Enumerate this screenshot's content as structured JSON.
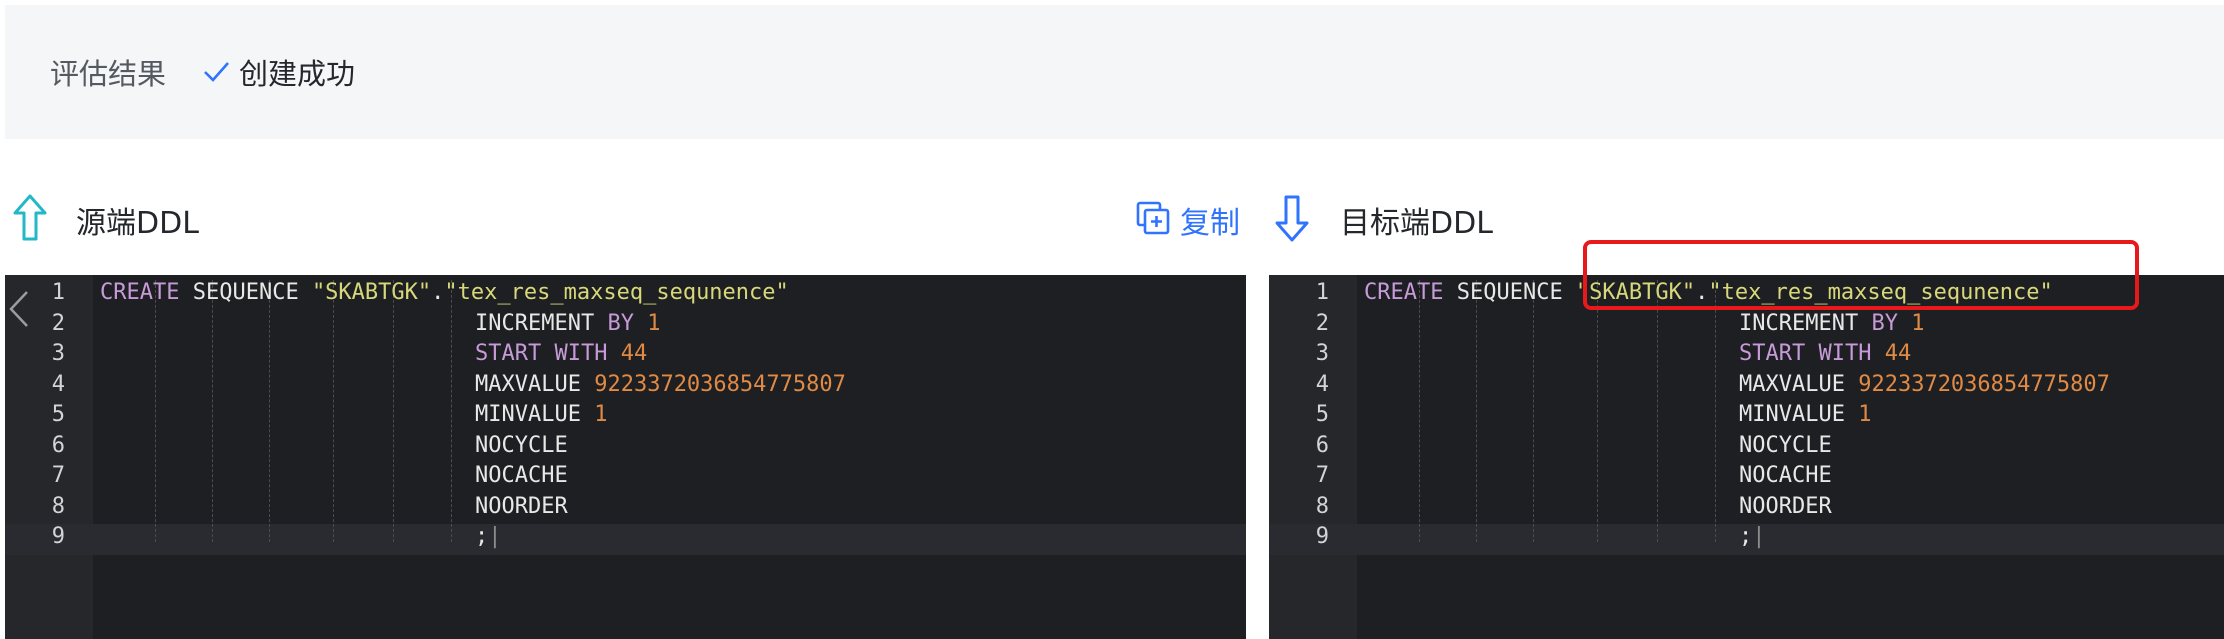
{
  "result": {
    "label": "评估结果",
    "status": "创建成功"
  },
  "source_panel": {
    "title": "源端DDL"
  },
  "target_panel": {
    "title": "目标端DDL"
  },
  "copy_button": {
    "label": "复制"
  },
  "code": {
    "line_numbers": [
      "1",
      "2",
      "3",
      "4",
      "5",
      "6",
      "7",
      "8",
      "9"
    ],
    "lines": [
      [
        {
          "t": "kw",
          "v": "CREATE"
        },
        {
          "t": "plain",
          "v": " SEQUENCE "
        },
        {
          "t": "str",
          "v": "\"SKABTGK\""
        },
        {
          "t": "plain",
          "v": "."
        },
        {
          "t": "str",
          "v": "\"tex_res_maxseq_sequnence\""
        }
      ],
      [
        {
          "t": "plain",
          "v": "INCREMENT "
        },
        {
          "t": "kw",
          "v": "BY"
        },
        {
          "t": "plain",
          "v": " "
        },
        {
          "t": "num",
          "v": "1"
        }
      ],
      [
        {
          "t": "kw",
          "v": "START WITH"
        },
        {
          "t": "plain",
          "v": " "
        },
        {
          "t": "num",
          "v": "44"
        }
      ],
      [
        {
          "t": "plain",
          "v": "MAXVALUE "
        },
        {
          "t": "num",
          "v": "9223372036854775807"
        }
      ],
      [
        {
          "t": "plain",
          "v": "MINVALUE "
        },
        {
          "t": "num",
          "v": "1"
        }
      ],
      [
        {
          "t": "plain",
          "v": "NOCYCLE"
        }
      ],
      [
        {
          "t": "plain",
          "v": "NOCACHE"
        }
      ],
      [
        {
          "t": "plain",
          "v": "NOORDER"
        }
      ],
      [
        {
          "t": "plain",
          "v": ";"
        }
      ]
    ]
  },
  "colors": {
    "accent": "#2f73ff",
    "success": "#2f73ff",
    "source_arrow": "#22b8c8",
    "target_arrow": "#2f73ff",
    "highlight": "#e8191a"
  }
}
